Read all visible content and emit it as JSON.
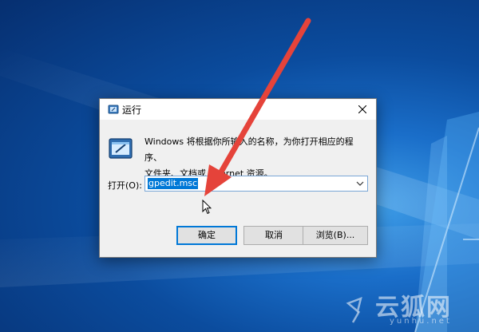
{
  "dialog": {
    "title": "运行",
    "description_line1": "Windows 将根据你所输入的名称，为你打开相应的程序、",
    "description_line2": "文件夹、文档或 Internet 资源。",
    "open_label": "打开(O):",
    "open_value": "gpedit.msc",
    "buttons": {
      "ok": "确定",
      "cancel": "取消",
      "browse": "浏览(B)..."
    }
  },
  "watermark": {
    "text": "云狐网",
    "url": "yunhu.net"
  },
  "icons": {
    "title_icon": "run-icon",
    "close_icon": "close-icon",
    "dropdown_icon": "chevron-down-icon",
    "cursor": "mouse-cursor-icon",
    "annotation": "red-arrow-annotation"
  },
  "colors": {
    "accent": "#0078d7",
    "arrow": "#e5433a",
    "dialog_bg": "#f0f0f0"
  }
}
